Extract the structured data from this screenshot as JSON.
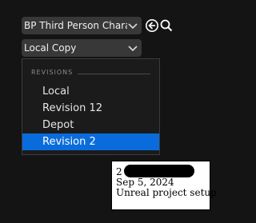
{
  "toolbar": {
    "blueprint_value": "BP Third Person Characte",
    "revision_value": "Local Copy"
  },
  "menu": {
    "section_title": "REVISIONS",
    "items": [
      {
        "label": "Local",
        "selected": false
      },
      {
        "label": "Revision 12",
        "selected": false
      },
      {
        "label": "Depot",
        "selected": false
      },
      {
        "label": "Revision 2",
        "selected": true
      }
    ]
  },
  "tooltip": {
    "line1": "2",
    "date": "Sep 5, 2024",
    "description": "Unreal project setup"
  },
  "colors": {
    "background": "#141414",
    "selection": "#0a6cdc",
    "combo": "#383838"
  },
  "icons": {
    "browse": "circle-arrow-left-icon",
    "search": "magnifier-icon",
    "dropdown": "chevron-down-icon"
  }
}
